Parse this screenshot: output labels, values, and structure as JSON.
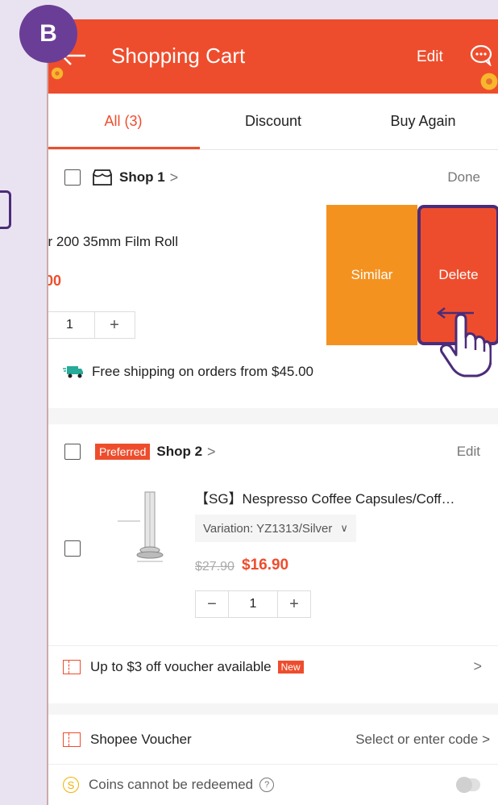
{
  "badge": {
    "label": "B"
  },
  "header": {
    "title": "Shopping Cart",
    "edit_label": "Edit"
  },
  "tabs": [
    {
      "label": "All (3)"
    },
    {
      "label": "Discount"
    },
    {
      "label": "Buy Again"
    }
  ],
  "shop1": {
    "name": "Shop 1",
    "done_label": "Done",
    "item": {
      "name_visible": "er 200 35mm Film Roll",
      "price_visible": "00",
      "quantity": "1",
      "plus": "+"
    },
    "actions": {
      "similar_label": "Similar",
      "delete_label": "Delete"
    }
  },
  "shipping": {
    "text": "Free shipping on orders from $45.00",
    "truck_tag": "Free"
  },
  "shop2": {
    "tag": "Preferred",
    "name": "Shop 2",
    "edit_label": "Edit",
    "item": {
      "name": "【SG】Nespresso Coffee Capsules/Coff…",
      "variation": "Variation: YZ1313/Silver",
      "old_price": "$27.90",
      "new_price": "$16.90",
      "quantity": "1",
      "minus": "−",
      "plus": "+"
    },
    "voucher": {
      "text": "Up to $3 off voucher available",
      "new_tag": "New"
    }
  },
  "shopee_voucher": {
    "label": "Shopee Voucher",
    "action": "Select or enter code"
  },
  "coins": {
    "text": "Coins cannot be redeemed",
    "coin_glyph": "S",
    "help_glyph": "?"
  },
  "colors": {
    "brand": "#ee4d2d",
    "similar": "#f49220",
    "badge": "#6a3e97",
    "highlight": "#4b2c78"
  }
}
